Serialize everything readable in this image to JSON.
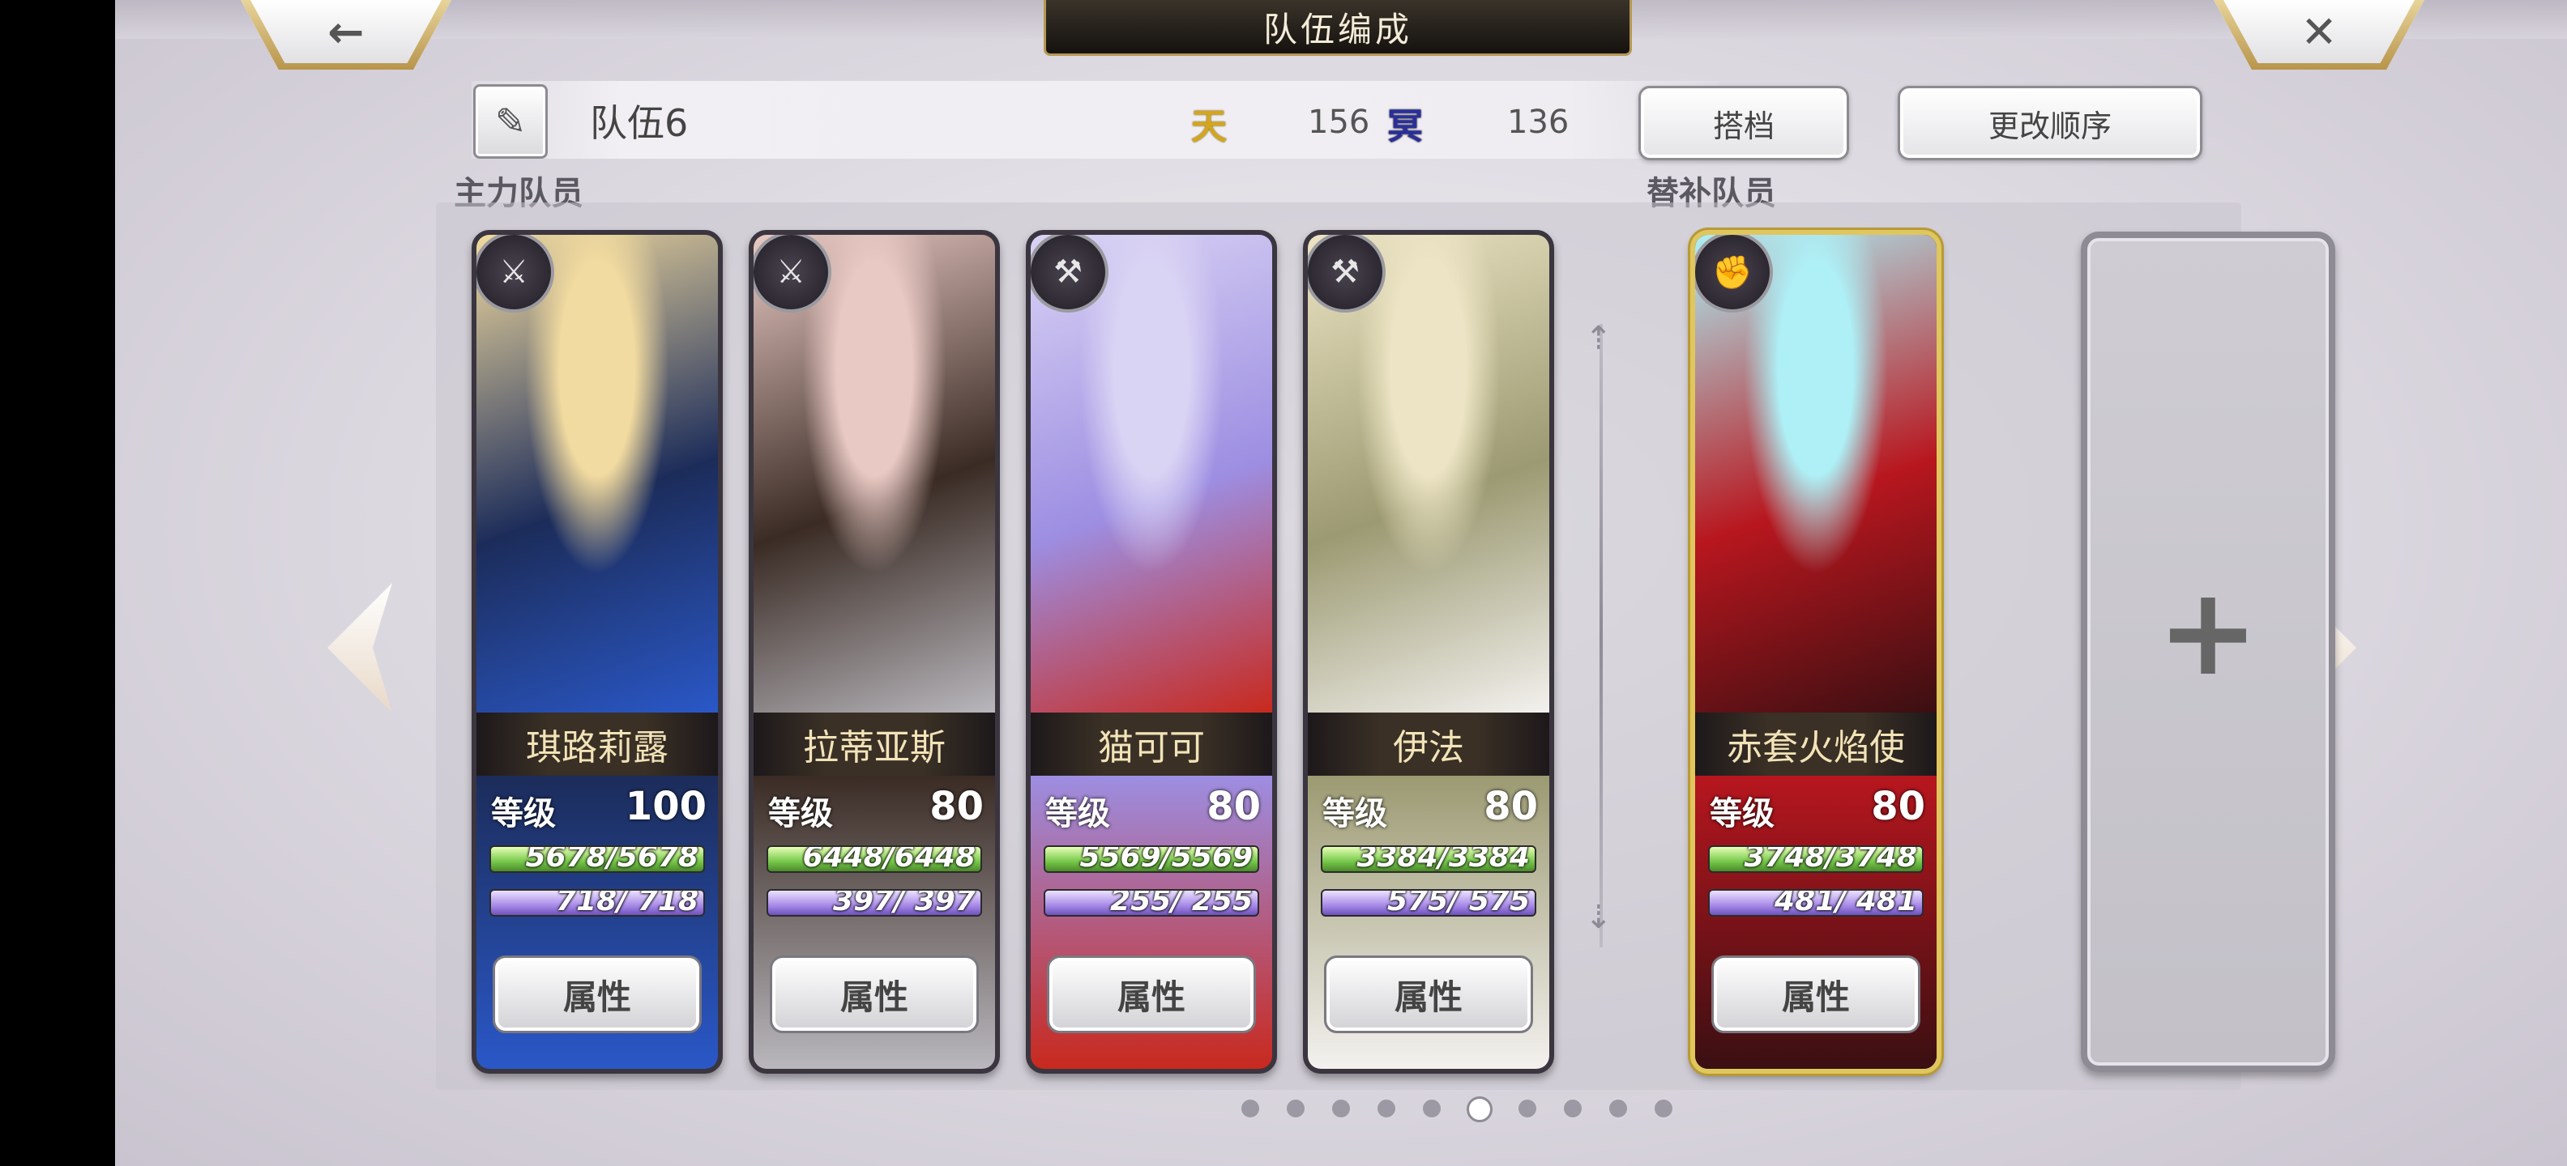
{
  "header": {
    "title": "队伍编成",
    "back_icon": "←",
    "close_icon": "✕"
  },
  "team": {
    "name": "队伍6",
    "sun_icon": "天",
    "sun_value": "156",
    "moon_icon": "冥",
    "moon_value": "136",
    "partner_label": "搭档",
    "order_label": "更改顺序"
  },
  "sections": {
    "main_label": "主力队员",
    "sub_label": "替补队员"
  },
  "main_members": [
    {
      "name": "琪路莉露",
      "level_label": "等级",
      "level": "100",
      "hp": "5678/5678",
      "mp": "718/ 718",
      "attr_label": "属性",
      "weapon": "sword-icon",
      "weapon_glyph": "⚔",
      "palette": [
        "#f2dba0",
        "#1c2c5a",
        "#2a58c8"
      ]
    },
    {
      "name": "拉蒂亚斯",
      "level_label": "等级",
      "level": "80",
      "hp": "6448/6448",
      "mp": "397/ 397",
      "attr_label": "属性",
      "weapon": "sword-icon",
      "weapon_glyph": "⚔",
      "palette": [
        "#e9c9c4",
        "#3a2b24",
        "#b9b7bd"
      ]
    },
    {
      "name": "猫可可",
      "level_label": "等级",
      "level": "80",
      "hp": "5569/5569",
      "mp": "255/ 255",
      "attr_label": "属性",
      "weapon": "axe-icon",
      "weapon_glyph": "⚒",
      "palette": [
        "#d9d3f4",
        "#9d8ee2",
        "#c8291e"
      ]
    },
    {
      "name": "伊法",
      "level_label": "等级",
      "level": "80",
      "hp": "3384/3384",
      "mp": "575/ 575",
      "attr_label": "属性",
      "weapon": "hammer-icon",
      "weapon_glyph": "⚒",
      "palette": [
        "#ece4c4",
        "#9c9a72",
        "#f3f1ee"
      ]
    }
  ],
  "sub_members": [
    {
      "name": "赤套火焰使",
      "level_label": "等级",
      "level": "80",
      "hp": "3748/3748",
      "mp": "481/ 481",
      "attr_label": "属性",
      "weapon": "fist-icon",
      "weapon_glyph": "✊",
      "palette": [
        "#aef0f6",
        "#b8161e",
        "#3a0f12"
      ]
    }
  ],
  "empty_slot_icon": "+",
  "pagination": {
    "total": 10,
    "active_index": 5
  },
  "colors": {
    "gold_frame": "#e0c65e",
    "hp_green": "#76c84a",
    "mp_purple": "#a98be8"
  }
}
